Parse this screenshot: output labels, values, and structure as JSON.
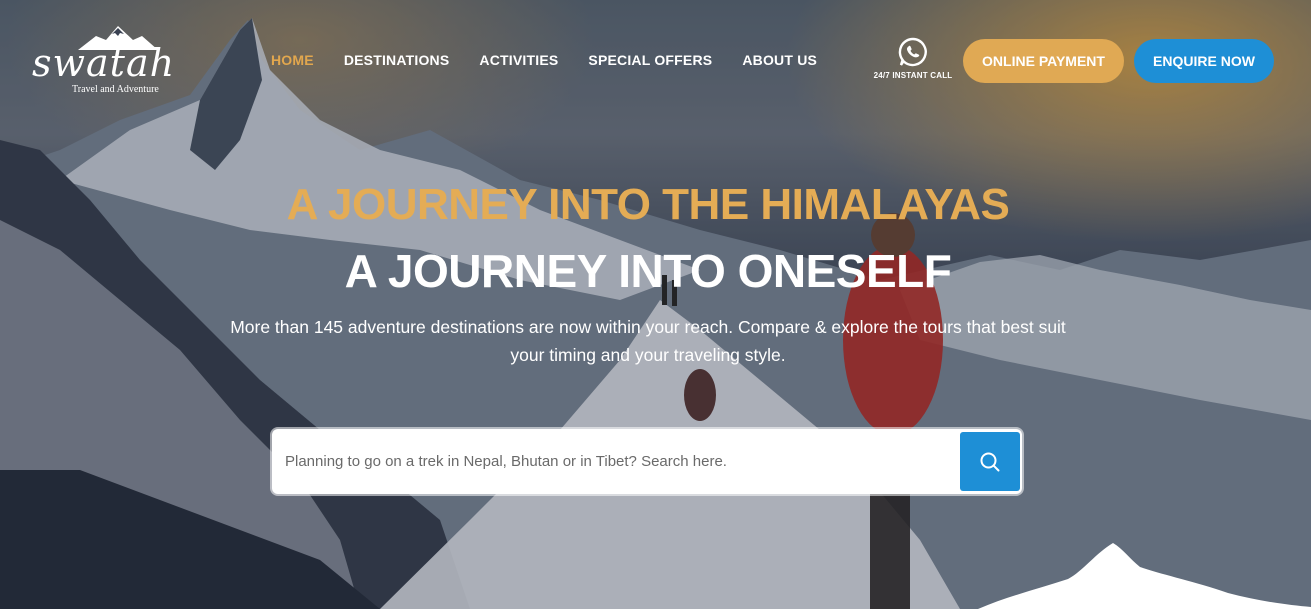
{
  "brand": {
    "name": "swatah",
    "tagline": "Travel and Adventure"
  },
  "nav": {
    "items": [
      {
        "label": "HOME",
        "active": true
      },
      {
        "label": "DESTINATIONS",
        "active": false
      },
      {
        "label": "ACTIVITIES",
        "active": false
      },
      {
        "label": "SPECIAL OFFERS",
        "active": false
      },
      {
        "label": "ABOUT US",
        "active": false
      }
    ]
  },
  "whatsapp": {
    "icon": "whatsapp-icon",
    "label": "24/7 INSTANT CALL"
  },
  "buttons": {
    "online_payment": "ONLINE PAYMENT",
    "enquire_now": "ENQUIRE NOW"
  },
  "hero": {
    "headline_1": "A JOURNEY INTO THE HIMALAYAS",
    "headline_2": "A JOURNEY INTO ONESELF",
    "subtitle": "More than 145 adventure destinations are now within your reach. Compare & explore the tours that best suit your timing and your traveling style."
  },
  "search": {
    "placeholder": "Planning to go on a trek in Nepal, Bhutan or in Tibet? Search here.",
    "value": "",
    "icon": "search-icon"
  },
  "colors": {
    "accent_gold": "#e0a954",
    "accent_blue": "#1e8fd6",
    "text_white": "#ffffff"
  }
}
